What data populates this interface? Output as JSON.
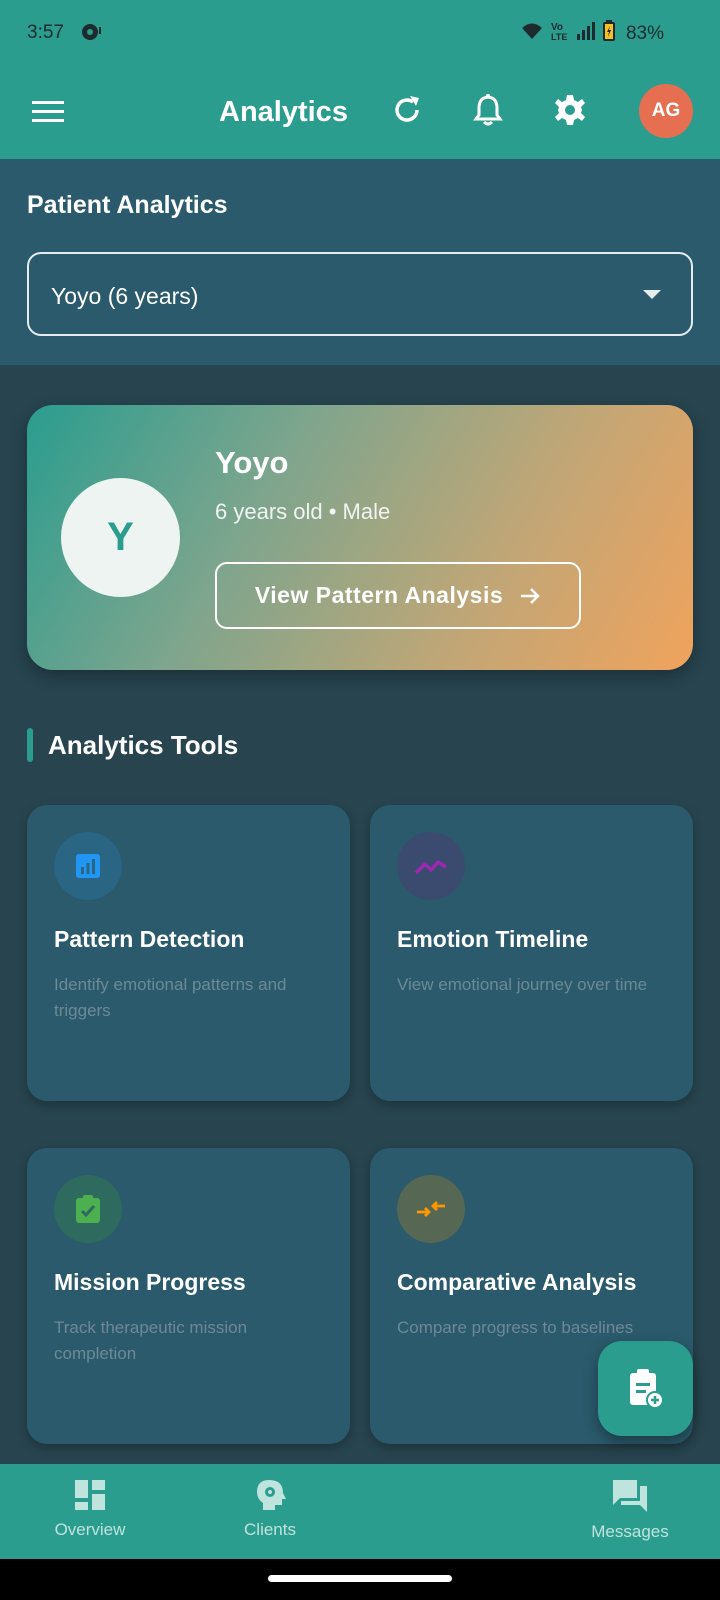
{
  "status_bar": {
    "time": "3:57",
    "battery": "83%"
  },
  "app_bar": {
    "title": "Analytics",
    "avatar_initials": "AG",
    "avatar_color": "#e76f51"
  },
  "patient_section": {
    "heading": "Patient Analytics",
    "selected_patient": "Yoyo (6 years)"
  },
  "patient_card": {
    "initial": "Y",
    "name": "Yoyo",
    "details": "6 years old • Male",
    "button_label": "View Pattern Analysis"
  },
  "tools": {
    "heading": "Analytics Tools",
    "items": [
      {
        "title": "Pattern Detection",
        "description": "Identify emotional patterns and triggers",
        "icon": "bar-chart-icon",
        "color": "#2196f3"
      },
      {
        "title": "Emotion Timeline",
        "description": "View emotional journey over time",
        "icon": "trend-line-icon",
        "color": "#9c27b0"
      },
      {
        "title": "Mission Progress",
        "description": "Track therapeutic mission completion",
        "icon": "clipboard-check-icon",
        "color": "#4caf50"
      },
      {
        "title": "Comparative Analysis",
        "description": "Compare progress to baselines",
        "icon": "compare-arrows-icon",
        "color": "#ff9800"
      }
    ]
  },
  "bottom_nav": {
    "items": [
      {
        "label": "Overview",
        "icon": "dashboard-icon"
      },
      {
        "label": "Clients",
        "icon": "head-gear-icon"
      },
      {
        "label": "Messages",
        "icon": "chat-icon"
      }
    ]
  },
  "colors": {
    "primary": "#2a9d8f",
    "background": "#27444f",
    "card": "#2a5a6b"
  }
}
